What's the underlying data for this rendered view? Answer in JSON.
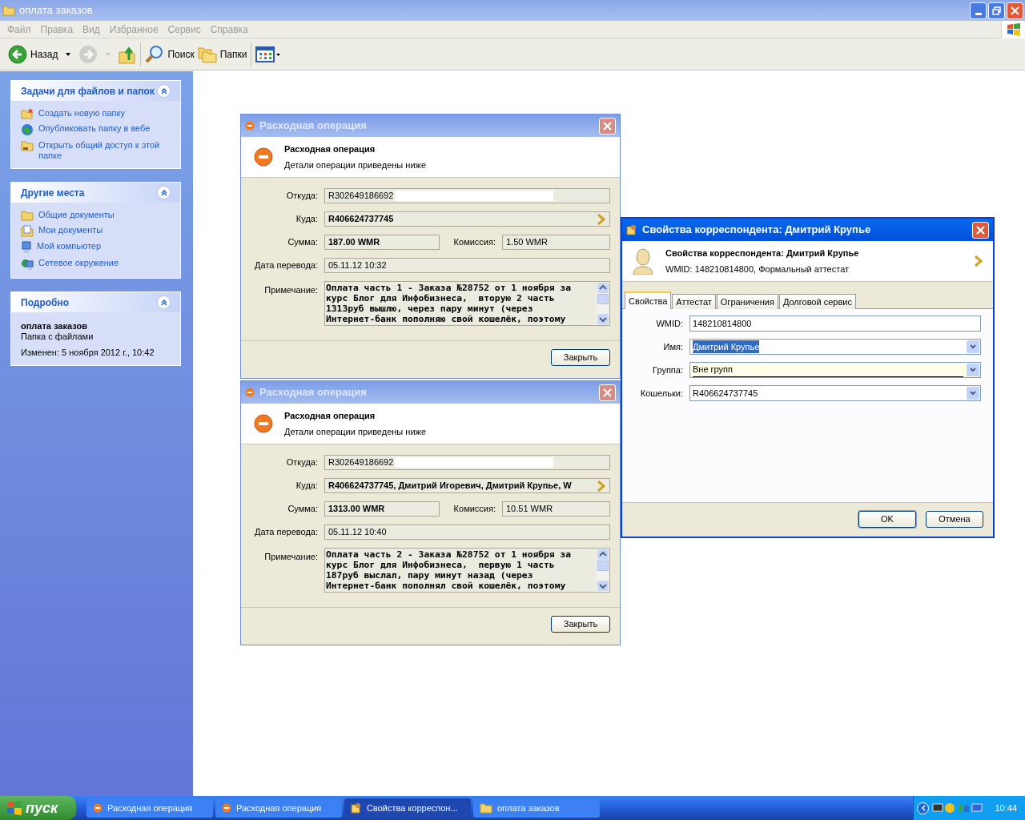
{
  "window": {
    "title": "оплата заказов",
    "active": false
  },
  "menu": [
    "Файл",
    "Правка",
    "Вид",
    "Избранное",
    "Сервис",
    "Справка"
  ],
  "toolbar": [
    {
      "kind": "back",
      "label": "Назад",
      "disabled": false
    },
    {
      "kind": "forward",
      "disabled": true
    },
    {
      "kind": "up",
      "disabled": false
    },
    {
      "kind": "search",
      "label": "Поиск",
      "disabled": false
    },
    {
      "kind": "folders",
      "label": "Папки",
      "disabled": false
    },
    {
      "kind": "views",
      "disabled": false
    }
  ],
  "sidebar": [
    {
      "kind": "links",
      "title": "Задачи для файлов и папок",
      "items": [
        {
          "kind": "new-folder",
          "label": "Создать новую папку"
        },
        {
          "kind": "globe",
          "label": "Опубликовать папку в вебе"
        },
        {
          "kind": "share-folder",
          "label": "Открыть общий доступ к этой папке"
        }
      ]
    },
    {
      "kind": "links",
      "title": "Другие места",
      "items": [
        {
          "kind": "folder",
          "label": "Общие документы"
        },
        {
          "kind": "documents",
          "label": "Мои документы"
        },
        {
          "kind": "computer",
          "label": "Мой компьютер"
        },
        {
          "kind": "network",
          "label": "Сетевое окружение"
        }
      ]
    },
    {
      "kind": "details",
      "title": "Подробно",
      "name": "оплата заказов",
      "type": "Папка с файлами",
      "modified": "Изменен: 5 ноября 2012 г., 10:42"
    }
  ],
  "operations": [
    {
      "title": "Расходная операция",
      "active": false,
      "heading": "Расходная операция",
      "subheading": "Детали операции приведены ниже",
      "from_label": "Откуда:",
      "from": "R302649186692",
      "to_label": "Куда:",
      "to": "R406624737745",
      "amount_label": "Сумма:",
      "amount": "187.00 WMR",
      "commission_label": "Комиссия:",
      "commission": "1.50 WMR",
      "date_label": "Дата перевода:",
      "date": "05.11.12 10:32",
      "note_label": "Примечание:",
      "note_lines": [
        "Оплата часть 1 - Заказа №28752 от 1 ноября за",
        "курс Блог для Инфобизнеса,  вторую 2 часть",
        "1313руб вышлю, через пару минут (через",
        "Интернет-банк пополняю свой кошелёк, поэтому"
      ],
      "close_button": "Закрыть"
    },
    {
      "title": "Расходная операция",
      "active": false,
      "heading": "Расходная операция",
      "subheading": "Детали операции приведены ниже",
      "from_label": "Откуда:",
      "from": "R302649186692",
      "to_label": "Куда:",
      "to": "R406624737745, Дмитрий Игоревич, Дмитрий Крупье, W",
      "amount_label": "Сумма:",
      "amount": "1313.00 WMR",
      "commission_label": "Комиссия:",
      "commission": "10.51 WMR",
      "date_label": "Дата перевода:",
      "date": "05.11.12 10:40",
      "note_label": "Примечание:",
      "note_lines": [
        "Оплата часть 2 - Заказа №28752 от 1 ноября за",
        "курс Блог для Инфобизнеса,  первую 1 часть",
        "187руб выслал, пару минут назад (через",
        "Интернет-банк пополнял свой кошелёк, поэтому"
      ],
      "close_button": "Закрыть"
    }
  ],
  "correspondent": {
    "title": "Свойства корреспондента: Дмитрий Крупье",
    "active": true,
    "heading": "Свойства корреспондента: Дмитрий Крупье",
    "subheading": "WMID: 148210814800, Формальный аттестат",
    "tabs": [
      {
        "label": "Свойства",
        "selected": true
      },
      {
        "label": "Аттестат",
        "selected": false
      },
      {
        "label": "Ограничения",
        "selected": false
      },
      {
        "label": "Долговой сервис",
        "selected": false
      }
    ],
    "fields": [
      {
        "kind": "text",
        "label": "WMID:",
        "value": "148210814800",
        "text_selected": false,
        "focused": false
      },
      {
        "kind": "select",
        "label": "Имя:",
        "value": "Дмитрий Крупье",
        "text_selected": true,
        "focused": false
      },
      {
        "kind": "select",
        "label": "Группа:",
        "value": "Вне групп",
        "text_selected": false,
        "focused": true
      },
      {
        "kind": "select",
        "label": "Кошельки:",
        "value": "R406624737745",
        "text_selected": false,
        "focused": false
      }
    ],
    "buttons": [
      {
        "label": "OK",
        "default": true
      },
      {
        "label": "Отмена",
        "default": false
      }
    ]
  },
  "taskbar": {
    "start": "пуск",
    "buttons": [
      {
        "kind": "operation",
        "label": "Расходная операция",
        "selected": false
      },
      {
        "kind": "operation",
        "label": "Расходная операция",
        "selected": false
      },
      {
        "kind": "contact",
        "label": "Свойства корреспон...",
        "selected": true
      },
      {
        "kind": "folder",
        "label": "оплата заказов",
        "selected": false
      }
    ],
    "clock": "10:44"
  }
}
